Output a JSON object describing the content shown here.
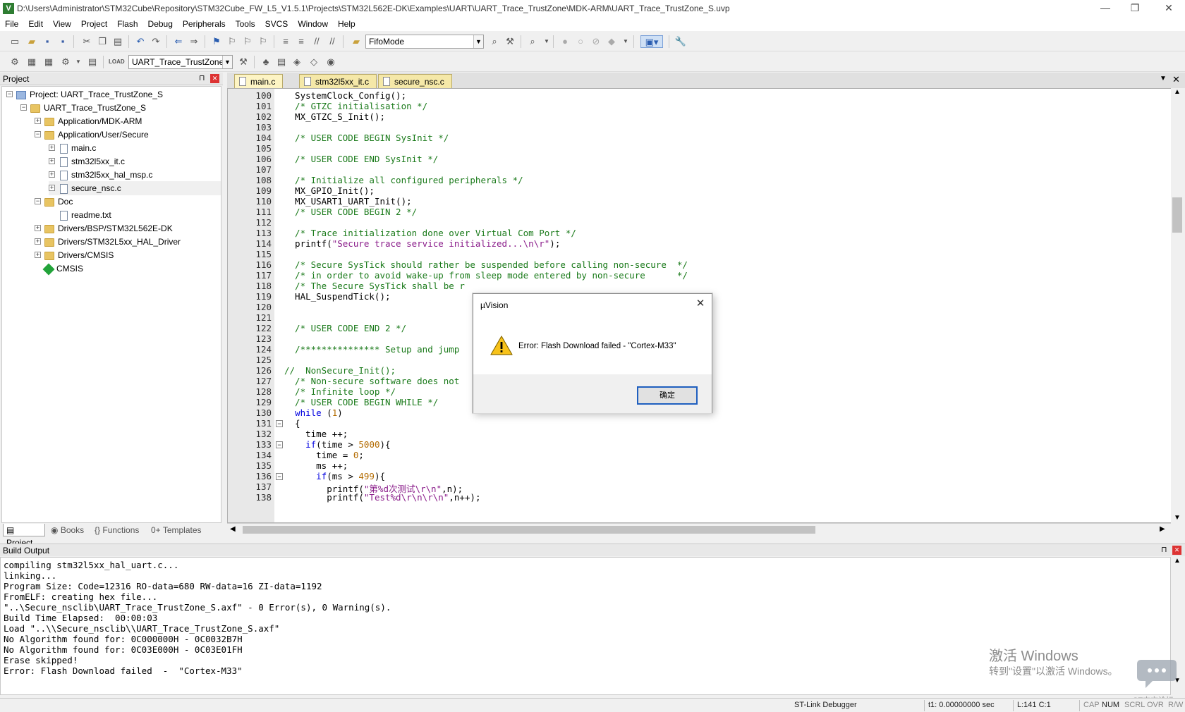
{
  "titlebar": {
    "path": "D:\\Users\\Administrator\\STM32Cube\\Repository\\STM32Cube_FW_L5_V1.5.1\\Projects\\STM32L562E-DK\\Examples\\UART\\UART_Trace_TrustZone\\MDK-ARM\\UART_Trace_TrustZone_S.uvp",
    "min": "—",
    "restore": "❐",
    "close": "✕"
  },
  "menu": [
    "File",
    "Edit",
    "View",
    "Project",
    "Flash",
    "Debug",
    "Peripherals",
    "Tools",
    "SVCS",
    "Window",
    "Help"
  ],
  "toolbar": {
    "find_combo": "FifoMode",
    "target_combo": "UART_Trace_TrustZone_S"
  },
  "project": {
    "header": "Project",
    "pin": "⊓",
    "close": "✕",
    "tree": [
      {
        "label": "Project: UART_Trace_TrustZone_S"
      },
      {
        "label": "UART_Trace_TrustZone_S"
      },
      {
        "label": "Application/MDK-ARM"
      },
      {
        "label": "Application/User/Secure"
      },
      {
        "label": "main.c"
      },
      {
        "label": "stm32l5xx_it.c"
      },
      {
        "label": "stm32l5xx_hal_msp.c"
      },
      {
        "label": "secure_nsc.c"
      },
      {
        "label": "Doc"
      },
      {
        "label": "readme.txt"
      },
      {
        "label": "Drivers/BSP/STM32L562E-DK"
      },
      {
        "label": "Drivers/STM32L5xx_HAL_Driver"
      },
      {
        "label": "Drivers/CMSIS"
      },
      {
        "label": "CMSIS"
      }
    ],
    "tabs": [
      "Project",
      "Books",
      "Functions",
      "Templates"
    ],
    "tab_glyphs": [
      "▤",
      "◉",
      "{}",
      "0+"
    ]
  },
  "editor": {
    "tabs": [
      "main.c",
      "stm32l5xx_it.c",
      "secure_nsc.c"
    ],
    "lines": [
      {
        "n": "100",
        "t": "  SystemClock_Config();"
      },
      {
        "n": "101",
        "t": "  /* GTZC initialisation */"
      },
      {
        "n": "102",
        "t": "  MX_GTZC_S_Init();"
      },
      {
        "n": "103",
        "t": ""
      },
      {
        "n": "104",
        "t": "  /* USER CODE BEGIN SysInit */"
      },
      {
        "n": "105",
        "t": ""
      },
      {
        "n": "106",
        "t": "  /* USER CODE END SysInit */"
      },
      {
        "n": "107",
        "t": ""
      },
      {
        "n": "108",
        "t": "  /* Initialize all configured peripherals */"
      },
      {
        "n": "109",
        "t": "  MX_GPIO_Init();"
      },
      {
        "n": "110",
        "t": "  MX_USART1_UART_Init();"
      },
      {
        "n": "111",
        "t": "  /* USER CODE BEGIN 2 */"
      },
      {
        "n": "112",
        "t": ""
      },
      {
        "n": "113",
        "t": "  /* Trace initialization done over Virtual Com Port */"
      },
      {
        "n": "114",
        "t": "  printf(\"Secure trace service initialized...\\n\\r\");"
      },
      {
        "n": "115",
        "t": ""
      },
      {
        "n": "116",
        "t": "  /* Secure SysTick should rather be suspended before calling non-secure  */"
      },
      {
        "n": "117",
        "t": "  /* in order to avoid wake-up from sleep mode entered by non-secure      */"
      },
      {
        "n": "118",
        "t": "  /* The Secure SysTick shall be r"
      },
      {
        "n": "119",
        "t": "  HAL_SuspendTick();"
      },
      {
        "n": "120",
        "t": ""
      },
      {
        "n": "121",
        "t": ""
      },
      {
        "n": "122",
        "t": "  /* USER CODE END 2 */"
      },
      {
        "n": "123",
        "t": ""
      },
      {
        "n": "124",
        "t": "  /*************** Setup and jump                                        ***/"
      },
      {
        "n": "125",
        "t": ""
      },
      {
        "n": "126",
        "t": "//  NonSecure_Init();"
      },
      {
        "n": "127",
        "t": "  /* Non-secure software does not"
      },
      {
        "n": "128",
        "t": "  /* Infinite loop */"
      },
      {
        "n": "129",
        "t": "  /* USER CODE BEGIN WHILE */"
      },
      {
        "n": "130",
        "t": "  while (1)"
      },
      {
        "n": "131",
        "t": "  {"
      },
      {
        "n": "132",
        "t": "    time ++;"
      },
      {
        "n": "133",
        "t": "    if(time > 5000){"
      },
      {
        "n": "134",
        "t": "      time = 0;"
      },
      {
        "n": "135",
        "t": "      ms ++;"
      },
      {
        "n": "136",
        "t": "      if(ms > 499){"
      },
      {
        "n": "137",
        "t": "        printf(\"第%d次测试\\r\\n\",n);"
      },
      {
        "n": "138",
        "t": "        printf(\"Test%d\\r\\n\\r\\n\",n++);"
      }
    ]
  },
  "build": {
    "header": "Build Output",
    "lines": [
      "compiling stm32l5xx_hal_uart.c...",
      "linking...",
      "Program Size: Code=12316 RO-data=680 RW-data=16 ZI-data=1192",
      "FromELF: creating hex file...",
      "\"..\\Secure_nsclib\\UART_Trace_TrustZone_S.axf\" - 0 Error(s), 0 Warning(s).",
      "Build Time Elapsed:  00:00:03",
      "Load \"..\\\\Secure_nsclib\\\\UART_Trace_TrustZone_S.axf\"",
      "No Algorithm found for: 0C000000H - 0C0032B7H",
      "No Algorithm found for: 0C03E000H - 0C03E01FH",
      "Erase skipped!",
      "Error: Flash Download failed  -  \"Cortex-M33\""
    ]
  },
  "status": {
    "debugger": "ST-Link Debugger",
    "time": "t1: 0.00000000 sec",
    "pos": "L:141 C:1",
    "cap": "CAP",
    "num": "NUM",
    "scrl": "SCRL",
    "ovr": "OVR",
    "rw": "R/W"
  },
  "watermark": {
    "line1": "激活 Windows",
    "line2": "转到\"设置\"以激活 Windows。",
    "line3": "ST中文论坛"
  },
  "dialog": {
    "title": "µVision",
    "message": "Error: Flash Download failed  -  \"Cortex-M33\"",
    "ok": "确定"
  },
  "colors": {
    "comment": "#1a7a1a",
    "keyword": "#0000e0",
    "string": "#8a1c8a",
    "number": "#b36b00"
  }
}
